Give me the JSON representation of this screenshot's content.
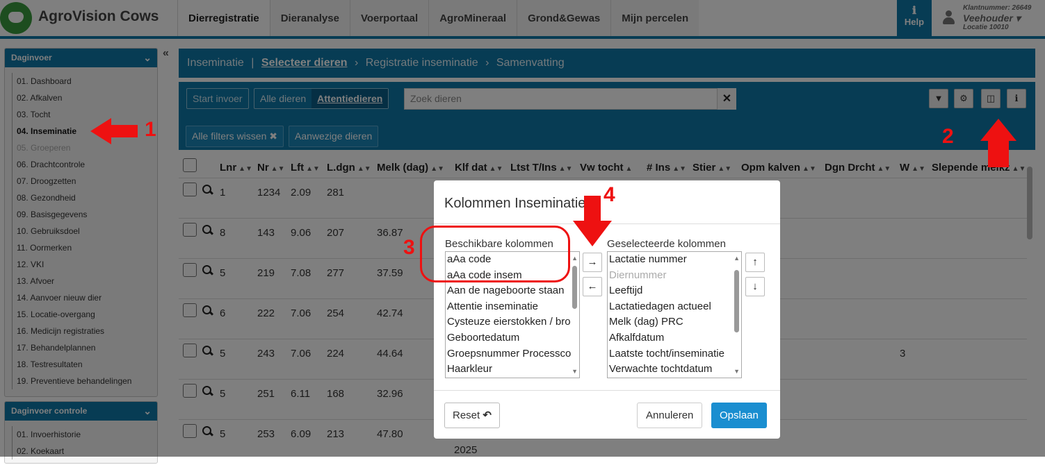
{
  "header": {
    "brand": "AgroVision Cows",
    "tabs": [
      "Dierregistratie",
      "Dieranalyse",
      "Voerportaal",
      "AgroMineraal",
      "Grond&Gewas",
      "Mijn percelen"
    ],
    "help_label": "Help",
    "help_icon": "info-icon",
    "user": {
      "klant": "Klantnummer: 26649",
      "role": "Veehouder",
      "location": "Locatie 10010"
    }
  },
  "sidebar": {
    "panel1_title": "Daginvoer",
    "panel1_items": [
      "01. Dashboard",
      "02. Afkalven",
      "03. Tocht",
      "04. Inseminatie",
      "05. Groeperen",
      "06. Drachtcontrole",
      "07. Droogzetten",
      "08. Gezondheid",
      "09. Basisgegevens",
      "10. Gebruiksdoel",
      "11. Oormerken",
      "12. VKI",
      "13. Afvoer",
      "14. Aanvoer nieuw dier",
      "15. Locatie-overgang",
      "16. Medicijn registraties",
      "17. Behandelplannen",
      "18. Testresultaten",
      "19. Preventieve behandelingen"
    ],
    "panel2_title": "Daginvoer controle",
    "panel2_items": [
      "01. Invoerhistorie",
      "02. Koekaart"
    ]
  },
  "breadcrumb": {
    "root": "Inseminatie",
    "sep": "|",
    "current": "Selecteer dieren",
    "step2": "Registratie inseminatie",
    "step3": "Samenvatting"
  },
  "toolbar": {
    "start": "Start invoer",
    "all_animals": "Alle dieren",
    "attention": "Attentiedieren",
    "search_placeholder": "Zoek dieren",
    "clear_filters": "Alle filters wissen",
    "present": "Aanwezige dieren"
  },
  "table": {
    "columns": [
      "Lnr",
      "Nr",
      "Lft",
      "L.dgn",
      "Melk (dag)",
      "Klf dat",
      "Ltst T/Ins",
      "Vw tocht",
      "# Ins",
      "Stier",
      "Opm kalven",
      "Dgn Drcht",
      "W",
      "Slepende melkz"
    ],
    "rows": [
      {
        "lnr": "1",
        "nr": "1234",
        "lft": "2.09",
        "ldgn": "281",
        "melk": "",
        "w": ""
      },
      {
        "lnr": "8",
        "nr": "143",
        "lft": "9.06",
        "ldgn": "207",
        "melk": "36.87",
        "w": ""
      },
      {
        "lnr": "5",
        "nr": "219",
        "lft": "7.08",
        "ldgn": "277",
        "melk": "37.59",
        "w": ""
      },
      {
        "lnr": "6",
        "nr": "222",
        "lft": "7.06",
        "ldgn": "254",
        "melk": "42.74",
        "w": ""
      },
      {
        "lnr": "5",
        "nr": "243",
        "lft": "7.06",
        "ldgn": "224",
        "melk": "44.64",
        "w": "3"
      },
      {
        "lnr": "5",
        "nr": "251",
        "lft": "6.11",
        "ldgn": "168",
        "melk": "32.96",
        "w": ""
      },
      {
        "lnr": "5",
        "nr": "253",
        "lft": "6.09",
        "ldgn": "213",
        "melk": "47.80",
        "w": ""
      }
    ],
    "last_fragment": "2025"
  },
  "modal": {
    "title": "Kolommen Inseminatie",
    "available_label": "Beschikbare kolommen",
    "selected_label": "Geselecteerde kolommen",
    "available": [
      "aAa code",
      "aAa code insem",
      "Aan de nageboorte staan",
      "Attentie inseminatie",
      "Cysteuze eierstokken / bronst",
      "Geboortedatum",
      "Groepsnummer Processcontrole",
      "Haarkleur"
    ],
    "selected": [
      "Lactatie nummer",
      "Diernummer",
      "Leeftijd",
      "Lactatiedagen actueel",
      "Melk (dag) PRC",
      "Afkalfdatum",
      "Laatste tocht/inseminatie",
      "Verwachte tochtdatum"
    ],
    "selected_disabled_index": 1,
    "reset": "Reset",
    "cancel": "Annuleren",
    "save": "Opslaan"
  },
  "annotations": {
    "n1": "1",
    "n2": "2",
    "n3": "3",
    "n4": "4",
    "color": "#e11111"
  }
}
